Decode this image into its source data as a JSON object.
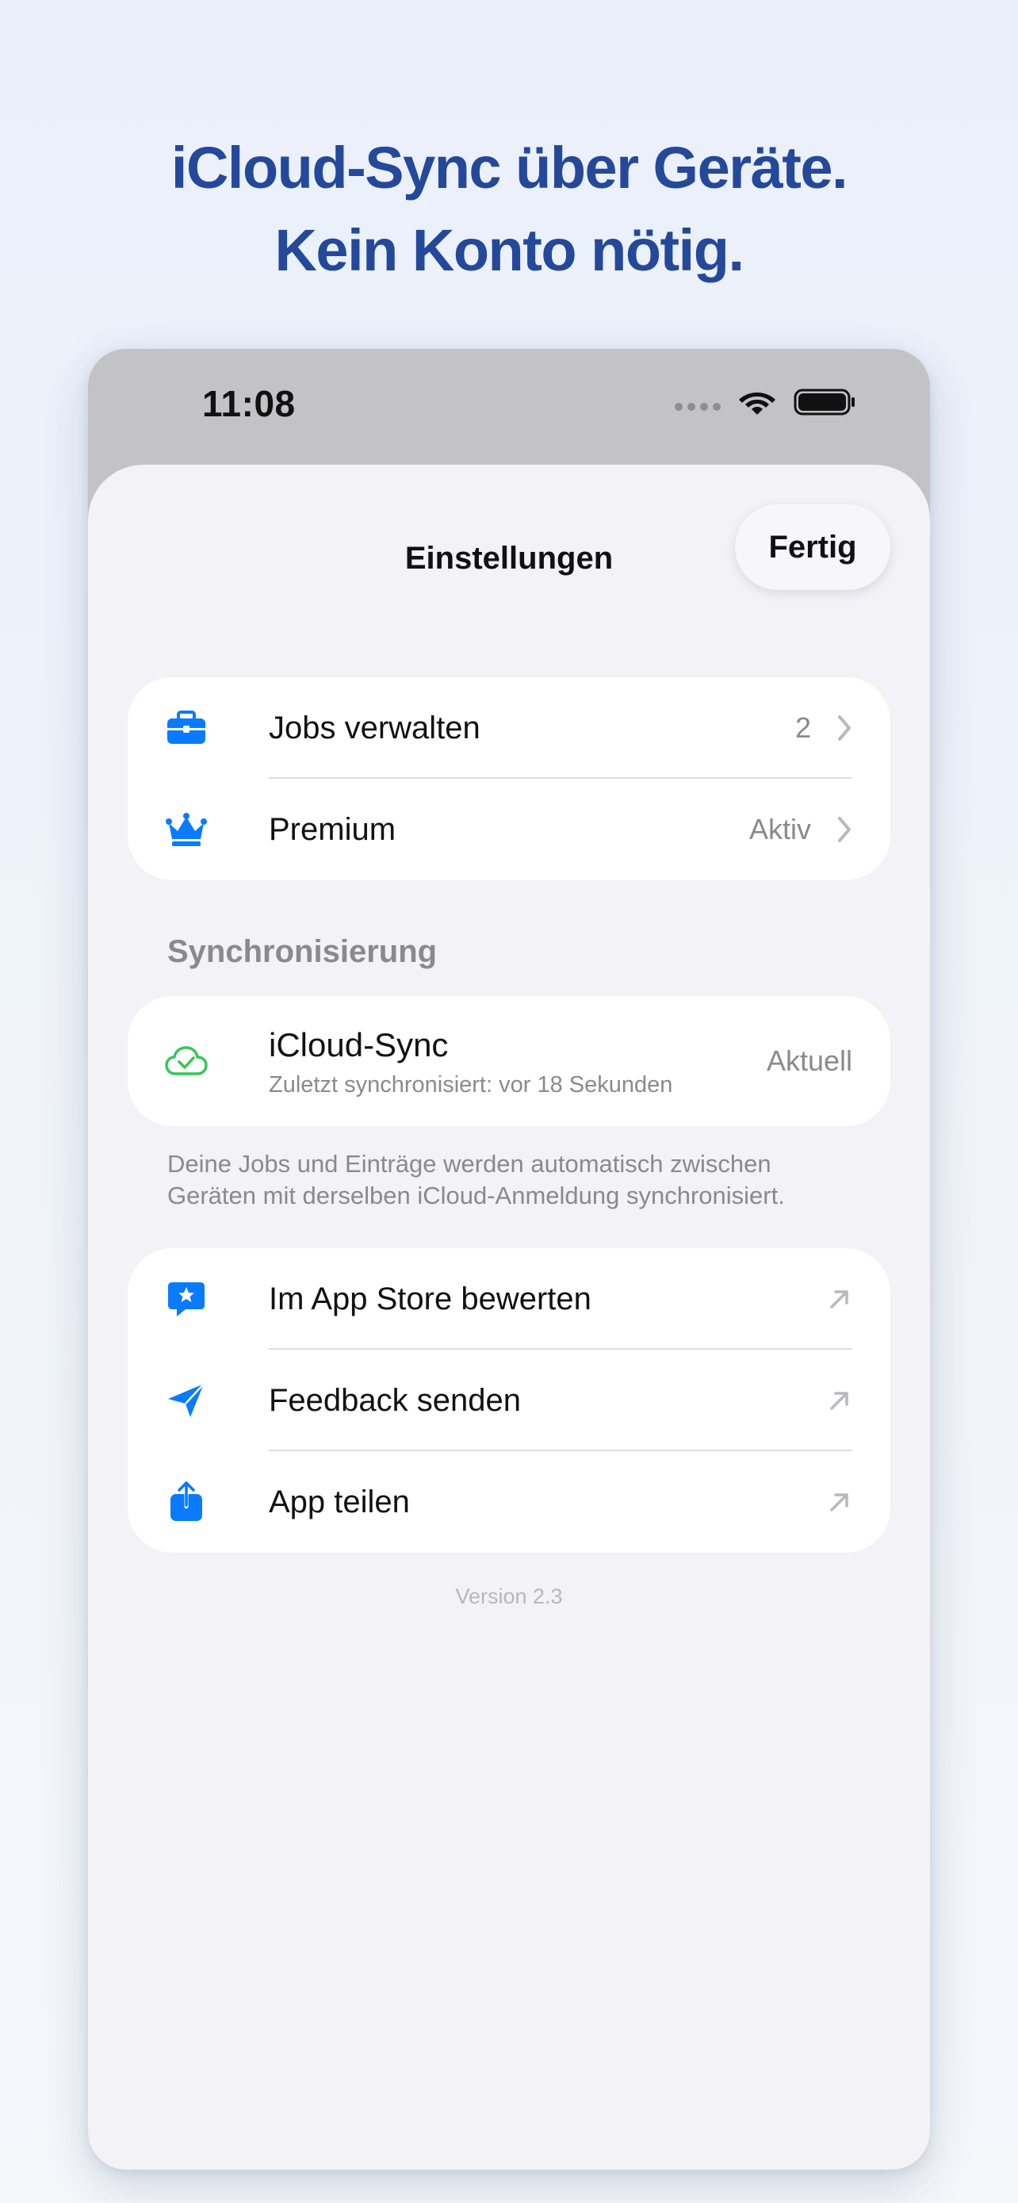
{
  "headline": {
    "line1": "iCloud-Sync über Geräte.",
    "line2": "Kein Konto nötig."
  },
  "status_bar": {
    "time": "11:08",
    "icons": [
      "signal-dots-icon",
      "wifi-icon",
      "battery-icon"
    ]
  },
  "nav": {
    "title": "Einstellungen",
    "done_label": "Fertig"
  },
  "group1": {
    "items": [
      {
        "label": "Jobs verwalten",
        "value": "2",
        "icon": "briefcase-icon"
      },
      {
        "label": "Premium",
        "value": "Aktiv",
        "icon": "crown-icon"
      }
    ]
  },
  "sync": {
    "section_header": "Synchronisierung",
    "title": "iCloud-Sync",
    "subtitle": "Zuletzt synchronisiert: vor 18 Sekunden",
    "status": "Aktuell",
    "icon": "cloud-check-icon",
    "footer_line1": "Deine Jobs und Einträge werden automatisch zwischen",
    "footer_line2": "Geräten mit derselben iCloud-Anmeldung synchronisiert."
  },
  "group2": {
    "items": [
      {
        "label": "Im App Store bewerten",
        "icon": "star-bubble-icon"
      },
      {
        "label": "Feedback senden",
        "icon": "paperplane-icon"
      },
      {
        "label": "App teilen",
        "icon": "share-icon"
      }
    ]
  },
  "version": "Version 2.3",
  "colors": {
    "headline": "#24489a",
    "accent_blue": "#0a7aff",
    "sync_green": "#34c759",
    "secondary_text": "#8a8a8e",
    "grouped_background": "#f2f2f7"
  }
}
